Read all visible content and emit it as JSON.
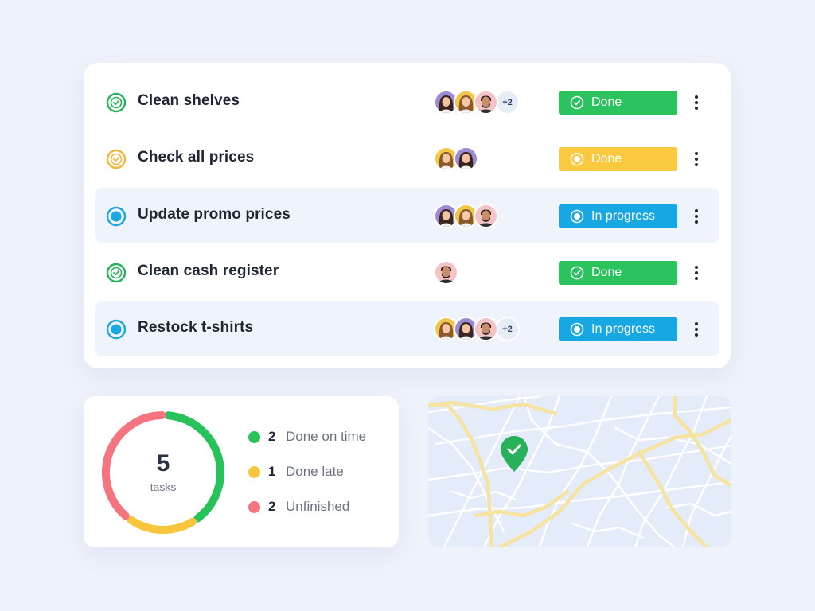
{
  "tasks": [
    {
      "name": "Clean shelves",
      "check_color": "#27b15b",
      "avatars": [
        "woman-dark",
        "woman-blonde",
        "man-beard"
      ],
      "extra": "+2",
      "status": "Done",
      "status_color": "#2ac35e",
      "status_icon": "check-circle-icon",
      "highlight": false
    },
    {
      "name": "Check all prices",
      "check_color": "#f2b63a",
      "avatars": [
        "woman-blonde",
        "woman-dark"
      ],
      "extra": "",
      "status": "Done",
      "status_color": "#fbc93f",
      "status_icon": "radio-dot-icon",
      "highlight": false
    },
    {
      "name": "Update promo prices",
      "check_color": "#1ba7e0",
      "avatars": [
        "woman-dark",
        "woman-blonde",
        "man-beard"
      ],
      "extra": "",
      "status": "In progress",
      "status_color": "#17a8e3",
      "status_icon": "radio-dot-icon",
      "highlight": true
    },
    {
      "name": "Clean cash register",
      "check_color": "#27b15b",
      "avatars": [
        "man-beard"
      ],
      "extra": "",
      "status": "Done",
      "status_color": "#2ac35e",
      "status_icon": "check-circle-icon",
      "highlight": false
    },
    {
      "name": "Restock t-shirts",
      "check_color": "#1ba7e0",
      "avatars": [
        "woman-blonde",
        "woman-dark",
        "man-beard"
      ],
      "extra": "+2",
      "status": "In progress",
      "status_color": "#17a8e3",
      "status_icon": "radio-dot-icon",
      "highlight": true
    }
  ],
  "summary": {
    "total": "5",
    "total_label": "tasks",
    "items": [
      {
        "count": "2",
        "label": "Done on time",
        "color": "#27c35a"
      },
      {
        "count": "1",
        "label": "Done late",
        "color": "#f8c63c"
      },
      {
        "count": "2",
        "label": "Unfinished",
        "color": "#f47480"
      }
    ]
  },
  "map": {
    "pin_icon": "map-pin-check-icon",
    "pin_color": "#27b15b"
  }
}
